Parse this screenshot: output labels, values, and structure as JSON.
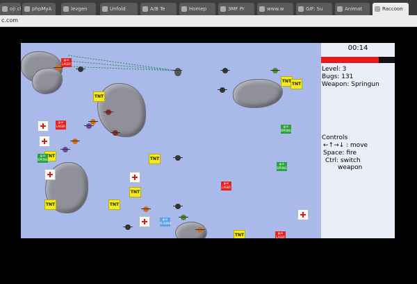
{
  "browser": {
    "tabs": [
      {
        "label": "oji cl"
      },
      {
        "label": "phpMyA"
      },
      {
        "label": "levgen"
      },
      {
        "label": "Unfold"
      },
      {
        "label": "A/B Te"
      },
      {
        "label": "Homep"
      },
      {
        "label": "3MF Pr"
      },
      {
        "label": "www.w"
      },
      {
        "label": "GIF: Su"
      },
      {
        "label": "Animat"
      },
      {
        "label": "Raccoon"
      }
    ],
    "url": "c.com"
  },
  "hud": {
    "timer": "00:14",
    "health_fraction": 0.78,
    "level": "Level: 3",
    "bugs": "Bugs: 131",
    "weapon": "Weapon: Springun",
    "controls_title": "Controls",
    "controls": [
      "←↑→↓ : move",
      "Space: fire",
      "Ctrl: switch",
      "weapon"
    ]
  },
  "pickups": {
    "tnt_label": "TNT",
    "laser_label": "gun LASER",
    "spring_label": "gun SPRING",
    "plasma_label": "gun PLASMA"
  },
  "colors": {
    "health": "#e51a1a",
    "field": "#a9b9ea",
    "tnt": "#f3ea1f"
  }
}
